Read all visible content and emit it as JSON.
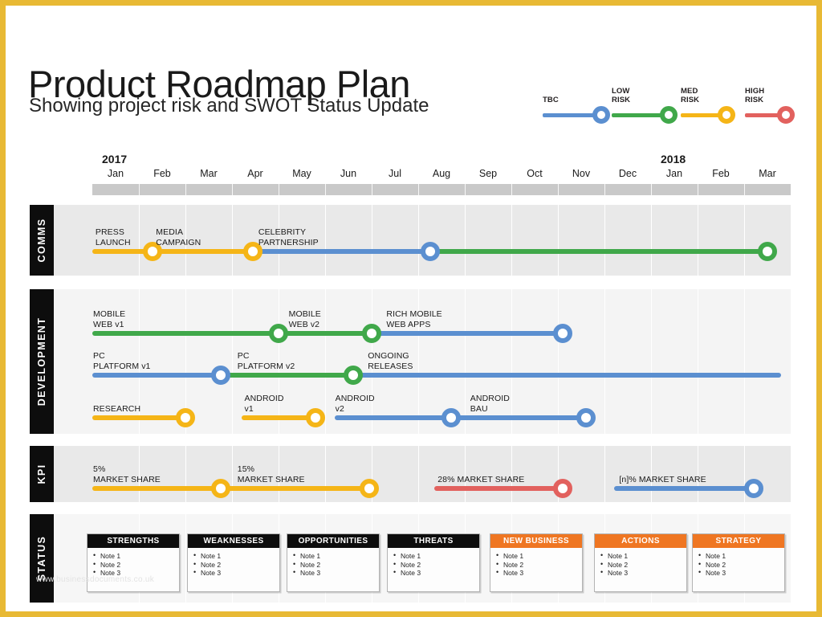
{
  "header": {
    "title": "Product Roadmap Plan",
    "subtitle": "Showing project risk and SWOT Status Update"
  },
  "legend": {
    "items": [
      {
        "label": "TBC",
        "color": "#5b8fd0"
      },
      {
        "label": "LOW\nRISK",
        "color": "#40a84a"
      },
      {
        "label": "MED\nRISK",
        "color": "#f5b517"
      },
      {
        "label": "HIGH\nRISK",
        "color": "#e2615e"
      }
    ]
  },
  "timeline": {
    "years": [
      {
        "label": "2017",
        "month_index": 0
      },
      {
        "label": "2018",
        "month_index": 12
      }
    ],
    "months": [
      "Jan",
      "Feb",
      "Mar",
      "Apr",
      "May",
      "Jun",
      "Jul",
      "Aug",
      "Sep",
      "Oct",
      "Nov",
      "Dec",
      "Jan",
      "Feb",
      "Mar"
    ]
  },
  "lanes": [
    {
      "name": "COMMS",
      "tracks": [
        {
          "label_segments": [
            {
              "text": "PRESS\nLAUNCH",
              "month": 0.05
            },
            {
              "text": "MEDIA\nCAMPAIGN",
              "month": 1.35
            },
            {
              "text": "CELEBRITY\nPARTNERSHIP",
              "month": 3.55
            }
          ],
          "bars": [
            {
              "from": 0.0,
              "to": 1.3,
              "color": "#f5b517"
            },
            {
              "from": 1.3,
              "to": 3.45,
              "color": "#f5b517"
            },
            {
              "from": 3.45,
              "to": 7.25,
              "color": "#5b8fd0"
            },
            {
              "from": 7.25,
              "to": 14.5,
              "color": "#40a84a"
            }
          ],
          "nodes": [
            {
              "month": 1.3,
              "color": "#f5b517"
            },
            {
              "month": 3.45,
              "color": "#f5b517"
            },
            {
              "month": 7.25,
              "color": "#5b8fd0"
            },
            {
              "month": 14.5,
              "color": "#40a84a"
            }
          ]
        }
      ]
    },
    {
      "name": "DEVELOPMENT",
      "tracks": [
        {
          "label_segments": [
            {
              "text": "MOBILE\nWEB v1",
              "month": 0.0
            },
            {
              "text": "MOBILE\nWEB v2",
              "month": 4.2
            },
            {
              "text": "RICH MOBILE\nWEB APPS",
              "month": 6.3
            }
          ],
          "bars": [
            {
              "from": 0.0,
              "to": 4.0,
              "color": "#40a84a"
            },
            {
              "from": 4.0,
              "to": 6.0,
              "color": "#40a84a"
            },
            {
              "from": 6.0,
              "to": 10.1,
              "color": "#5b8fd0"
            }
          ],
          "nodes": [
            {
              "month": 4.0,
              "color": "#40a84a"
            },
            {
              "month": 6.0,
              "color": "#40a84a"
            },
            {
              "month": 10.1,
              "color": "#5b8fd0"
            }
          ]
        },
        {
          "label_segments": [
            {
              "text": "PC\nPLATFORM v1",
              "month": 0.0
            },
            {
              "text": "PC\nPLATFORM v2",
              "month": 3.1
            },
            {
              "text": "ONGOING\nRELEASES",
              "month": 5.9
            }
          ],
          "bars": [
            {
              "from": 0.0,
              "to": 2.75,
              "color": "#5b8fd0"
            },
            {
              "from": 2.75,
              "to": 5.6,
              "color": "#40a84a"
            },
            {
              "from": 5.6,
              "to": 14.8,
              "color": "#5b8fd0"
            }
          ],
          "nodes": [
            {
              "month": 2.75,
              "color": "#5b8fd0"
            },
            {
              "month": 5.6,
              "color": "#40a84a"
            }
          ]
        },
        {
          "label_segments": [
            {
              "text": "RESEARCH",
              "month": 0.0
            },
            {
              "text": "ANDROID\nv1",
              "month": 3.25
            },
            {
              "text": "ANDROID\nv2",
              "month": 5.2
            },
            {
              "text": "ANDROID\nBAU",
              "month": 8.1
            }
          ],
          "bars": [
            {
              "from": 0.0,
              "to": 2.0,
              "color": "#f5b517"
            },
            {
              "from": 3.2,
              "to": 4.8,
              "color": "#f5b517"
            },
            {
              "from": 5.2,
              "to": 7.7,
              "color": "#5b8fd0"
            },
            {
              "from": 7.7,
              "to": 10.6,
              "color": "#5b8fd0"
            }
          ],
          "nodes": [
            {
              "month": 2.0,
              "color": "#f5b517"
            },
            {
              "month": 4.8,
              "color": "#f5b517"
            },
            {
              "month": 7.7,
              "color": "#5b8fd0"
            },
            {
              "month": 10.6,
              "color": "#5b8fd0"
            }
          ]
        }
      ]
    },
    {
      "name": "KPI",
      "tracks": [
        {
          "label_segments": [
            {
              "text": "5%\nMARKET SHARE",
              "month": 0.0
            },
            {
              "text": "15%\nMARKET SHARE",
              "month": 3.1
            },
            {
              "text": "28% MARKET SHARE",
              "month": 7.4
            },
            {
              "text": "[n]% MARKET SHARE",
              "month": 11.3
            }
          ],
          "bars": [
            {
              "from": 0.0,
              "to": 2.75,
              "color": "#f5b517"
            },
            {
              "from": 2.75,
              "to": 5.95,
              "color": "#f5b517"
            },
            {
              "from": 7.35,
              "to": 10.1,
              "color": "#e2615e"
            },
            {
              "from": 11.2,
              "to": 14.2,
              "color": "#5b8fd0"
            }
          ],
          "nodes": [
            {
              "month": 2.75,
              "color": "#f5b517"
            },
            {
              "month": 5.95,
              "color": "#f5b517"
            },
            {
              "month": 10.1,
              "color": "#e2615e"
            },
            {
              "month": 14.2,
              "color": "#5b8fd0"
            }
          ]
        }
      ]
    },
    {
      "name": "STATUS",
      "tracks": []
    }
  ],
  "swot": {
    "notes": [
      "Note 1",
      "Note 2",
      "Note 3"
    ],
    "boxes": [
      {
        "title": "STRENGTHS",
        "header_color": "#0d0d0d"
      },
      {
        "title": "WEAKNESSES",
        "header_color": "#0d0d0d"
      },
      {
        "title": "OPPORTUNITIES",
        "header_color": "#0d0d0d"
      },
      {
        "title": "THREATS",
        "header_color": "#0d0d0d"
      },
      {
        "title": "NEW BUSINESS",
        "header_color": "#ef7622"
      },
      {
        "title": "ACTIONS",
        "header_color": "#ef7622"
      },
      {
        "title": "STRATEGY",
        "header_color": "#ef7622"
      }
    ]
  },
  "watermark": "www.businessdocuments.co.uk"
}
